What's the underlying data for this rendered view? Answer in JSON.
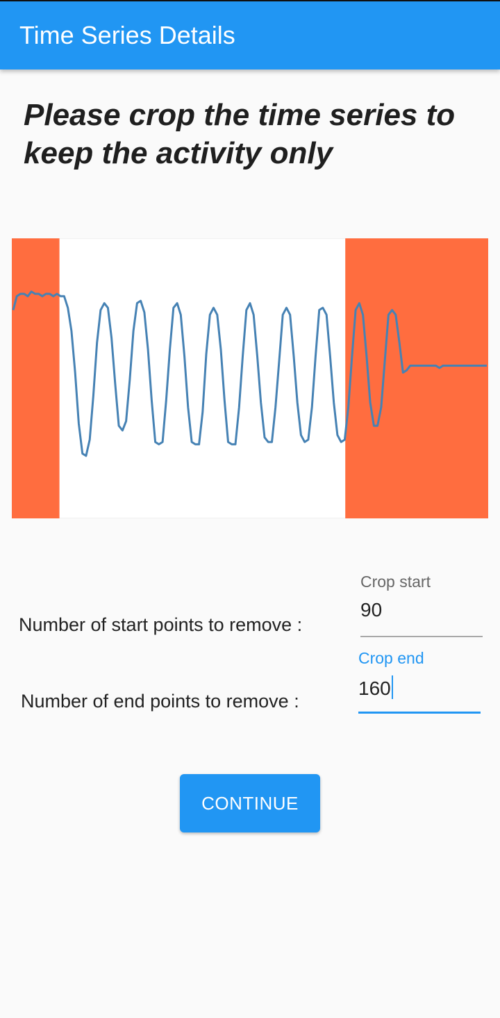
{
  "app_bar": {
    "title": "Time Series Details"
  },
  "instruction": "Please crop the time series to keep the activity only",
  "colors": {
    "primary": "#2196f3",
    "crop_region": "#ff6d3f",
    "series_line": "#4682b4",
    "background": "#fafafa"
  },
  "chart_data": {
    "type": "line",
    "series": [
      {
        "values": [
          0.72,
          0.78,
          0.79,
          0.79,
          0.78,
          0.8,
          0.79,
          0.79,
          0.78,
          0.79,
          0.79,
          0.78,
          0.79,
          0.78,
          0.78,
          0.73,
          0.63,
          0.45,
          0.23,
          0.1,
          0.09,
          0.16,
          0.35,
          0.58,
          0.72,
          0.75,
          0.73,
          0.6,
          0.4,
          0.22,
          0.2,
          0.24,
          0.42,
          0.63,
          0.75,
          0.76,
          0.71,
          0.55,
          0.33,
          0.15,
          0.14,
          0.15,
          0.33,
          0.55,
          0.73,
          0.75,
          0.7,
          0.52,
          0.3,
          0.15,
          0.14,
          0.14,
          0.28,
          0.53,
          0.7,
          0.73,
          0.7,
          0.55,
          0.33,
          0.15,
          0.14,
          0.14,
          0.3,
          0.52,
          0.72,
          0.75,
          0.7,
          0.52,
          0.32,
          0.17,
          0.15,
          0.15,
          0.3,
          0.5,
          0.7,
          0.73,
          0.7,
          0.52,
          0.32,
          0.18,
          0.15,
          0.16,
          0.3,
          0.52,
          0.72,
          0.73,
          0.7,
          0.52,
          0.32,
          0.18,
          0.15,
          0.16,
          0.3,
          0.52,
          0.72,
          0.75,
          0.7,
          0.52,
          0.32,
          0.22,
          0.22,
          0.3,
          0.5,
          0.7,
          0.72,
          0.7,
          0.58,
          0.45,
          0.46,
          0.48,
          0.48,
          0.48,
          0.48,
          0.48,
          0.48,
          0.48,
          0.48,
          0.47,
          0.48,
          0.48,
          0.48,
          0.48,
          0.48,
          0.48,
          0.48,
          0.48,
          0.48,
          0.48,
          0.48,
          0.48,
          0.48
        ]
      }
    ],
    "crop_start_fraction": 0.1,
    "crop_end_fraction": 0.3
  },
  "form": {
    "start_row_label": "Number of start points to remove :",
    "end_row_label": "Number of end points to remove :",
    "crop_start": {
      "label": "Crop start",
      "value": "90"
    },
    "crop_end": {
      "label": "Crop end",
      "value": "160"
    }
  },
  "continue_button": {
    "label": "CONTINUE"
  }
}
